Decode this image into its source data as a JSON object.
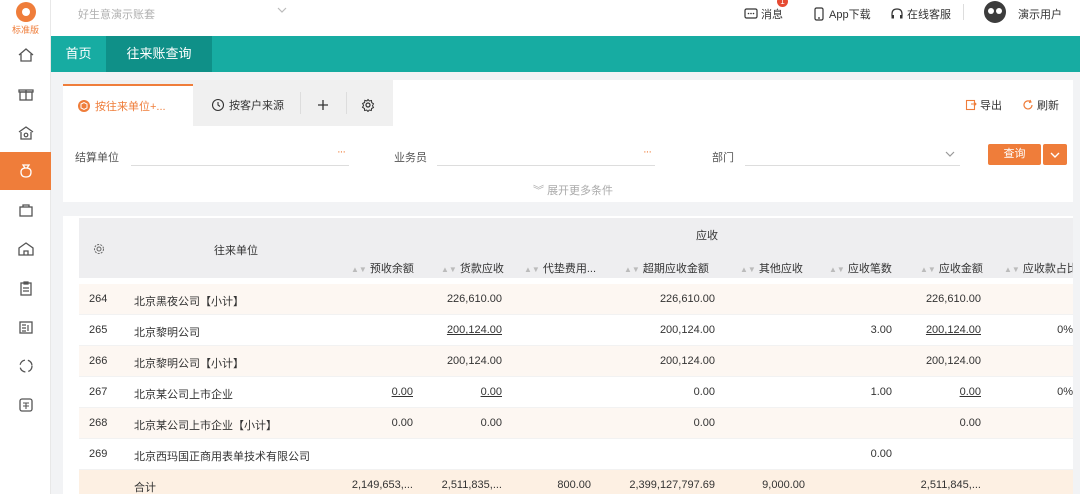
{
  "app": {
    "logo_text": "标准版",
    "account": "好生意演示账套"
  },
  "topbar": {
    "messages": "消息",
    "message_badge": "1",
    "app_download": "App下载",
    "service": "在线客服",
    "user": "演示用户"
  },
  "nav": {
    "tabs": [
      "首页",
      "往来账查询"
    ]
  },
  "view_tabs": [
    "按往来单位+...",
    "按客户来源"
  ],
  "tools": {
    "export": "导出",
    "refresh": "刷新"
  },
  "filters": {
    "settle_unit": "结算单位",
    "salesman": "业务员",
    "dept": "部门",
    "query": "查询",
    "expand": "展开更多条件"
  },
  "table": {
    "group_header": "应收",
    "columns": [
      "往来单位",
      "预收余额",
      "货款应收",
      "代垫费用...",
      "超期应收金额",
      "其他应收",
      "应收笔数",
      "应收金额",
      "应收款占比"
    ],
    "rows": [
      {
        "no": "264",
        "name": "北京黑夜公司【小计】",
        "c1": "",
        "c2": "226,610.00",
        "c3": "",
        "c4": "226,610.00",
        "c5": "",
        "c6": "",
        "c7": "226,610.00",
        "c8": ""
      },
      {
        "no": "265",
        "name": "北京黎明公司",
        "c1": "",
        "c2": "200,124.00",
        "c3": "",
        "c4": "200,124.00",
        "c5": "",
        "c6": "3.00",
        "c7": "200,124.00",
        "c8": "0%"
      },
      {
        "no": "266",
        "name": "北京黎明公司【小计】",
        "c1": "",
        "c2": "200,124.00",
        "c3": "",
        "c4": "200,124.00",
        "c5": "",
        "c6": "",
        "c7": "200,124.00",
        "c8": ""
      },
      {
        "no": "267",
        "name": "北京某公司上市企业",
        "c1": "0.00",
        "c2": "0.00",
        "c3": "",
        "c4": "0.00",
        "c5": "",
        "c6": "1.00",
        "c7": "0.00",
        "c8": "0%"
      },
      {
        "no": "268",
        "name": "北京某公司上市企业【小计】",
        "c1": "0.00",
        "c2": "0.00",
        "c3": "",
        "c4": "0.00",
        "c5": "",
        "c6": "",
        "c7": "0.00",
        "c8": ""
      },
      {
        "no": "269",
        "name": "北京西玛国正商用表单技术有限公司",
        "c1": "",
        "c2": "",
        "c3": "",
        "c4": "",
        "c5": "",
        "c6": "0.00",
        "c7": "",
        "c8": ""
      }
    ],
    "total": {
      "label": "合计",
      "c1": "2,149,653,...",
      "c2": "2,511,835,...",
      "c3": "800.00",
      "c4": "2,399,127,797.69",
      "c5": "9,000.00",
      "c6": "",
      "c7": "2,511,845,..."
    }
  },
  "colors": {
    "accent": "#ef7d3a",
    "nav": "#17aca2",
    "nav_active": "#0f9088"
  }
}
